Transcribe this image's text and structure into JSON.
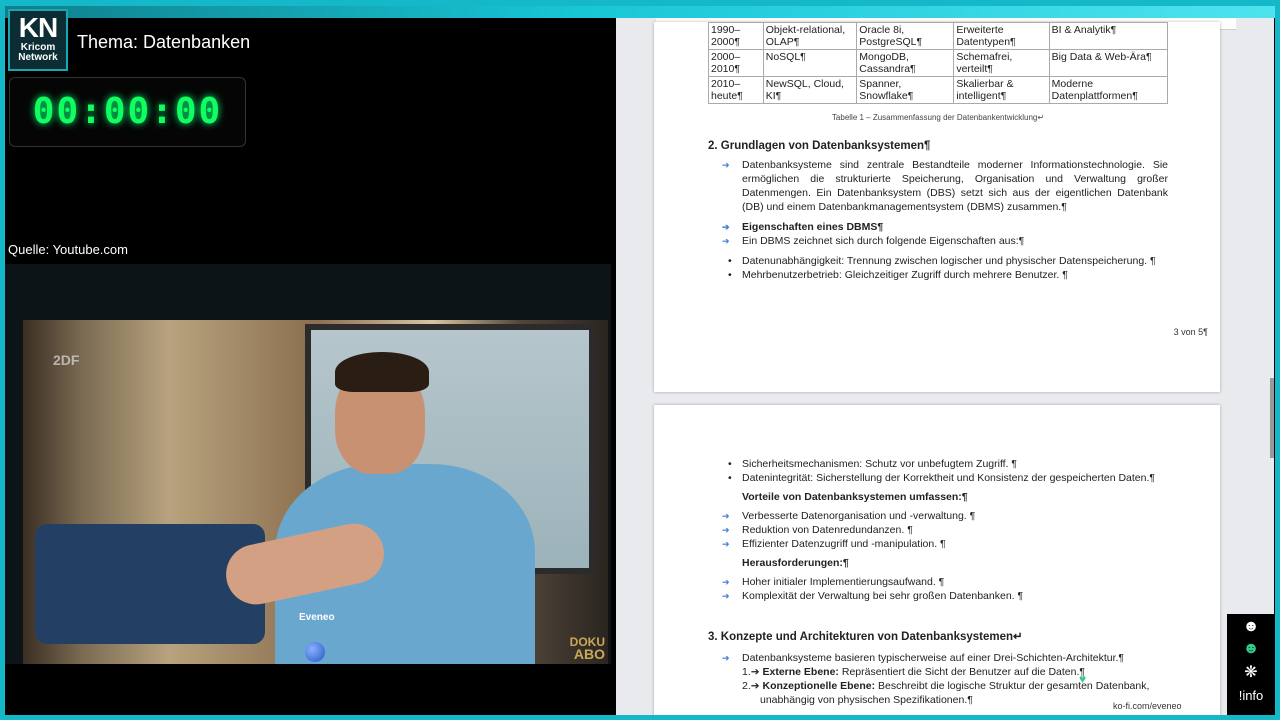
{
  "brand": {
    "logo_main": "KN",
    "logo_sub": "Kricom\nNetwork"
  },
  "header": {
    "topic": "Thema: Datenbanken"
  },
  "timer": {
    "value": "00:00:00"
  },
  "source": "Quelle: Youtube.com",
  "video": {
    "watermark": "2DF",
    "username": "Eveneo",
    "badge_top": "DOKU",
    "badge_bottom": "ABO"
  },
  "document": {
    "table_rows": [
      [
        "1990–2000¶",
        "Objekt-relational, OLAP¶",
        "Oracle 8i, PostgreSQL¶",
        "Erweiterte Datentypen¶",
        "BI & Analytik¶"
      ],
      [
        "2000–2010¶",
        "NoSQL¶",
        "MongoDB, Cassandra¶",
        "Schemafrei, verteilt¶",
        "Big Data & Web-Ära¶"
      ],
      [
        "2010–heute¶",
        "NewSQL, Cloud, KI¶",
        "Spanner, Snowflake¶",
        "Skalierbar & intelligent¶",
        "Moderne Datenplattformen¶"
      ]
    ],
    "caption": "Tabelle 1 – Zusammenfassung der Datenbankentwicklung↵",
    "section2_heading": "2. Grundlagen von Datenbanksystemen¶",
    "section2_para": "Datenbanksysteme sind zentrale Bestandteile moderner Informationstechnologie. Sie ermöglichen die strukturierte Speicherung, Organisation und Verwaltung großer Datenmengen. Ein Datenbanksystem (DBS) setzt sich aus der eigentlichen Datenbank (DB) und einem Datenbankmanagementsystem (DBMS) zusammen.¶",
    "dbms_heading": "Eigenschaften eines DBMS¶",
    "dbms_intro": "Ein DBMS zeichnet sich durch folgende Eigenschaften aus:¶",
    "dbms_props": [
      "Datenunabhängigkeit: Trennung zwischen logischer und physischer Datenspeicherung. ¶",
      "Mehrbenutzerbetrieb: Gleichzeitiger Zugriff durch mehrere Benutzer. ¶"
    ],
    "page_number": "3 von 5¶",
    "page2_bullets": [
      "Sicherheitsmechanismen: Schutz vor unbefugtem Zugriff. ¶",
      "Datenintegrität: Sicherstellung der Korrektheit und Konsistenz der gespeicherten Daten.¶"
    ],
    "advantages_heading": "Vorteile von Datenbanksystemen umfassen:¶",
    "advantages": [
      "Verbesserte Datenorganisation und -verwaltung. ¶",
      "Reduktion von Datenredundanzen. ¶",
      "Effizienter Datenzugriff und -manipulation. ¶"
    ],
    "challenges_heading": "Herausforderungen:¶",
    "challenges": [
      "Hoher initialer Implementierungsaufwand. ¶",
      "Komplexität der Verwaltung bei sehr großen Datenbanken. ¶"
    ],
    "section3_heading": "3. Konzepte und Architekturen von Datenbanksystemen↵",
    "section3_para": "Datenbanksysteme basieren typischerweise auf einer Drei-Schichten-Architektur.¶",
    "layers": [
      {
        "num": "1.➔",
        "name": "Externe Ebene:",
        "text": " Repräsentiert die Sicht der Benutzer auf die Daten.¶"
      },
      {
        "num": "2.➔",
        "name": "Konzeptionelle Ebene:",
        "text": " Beschreibt die logische Struktur der gesamten Datenbank,"
      }
    ],
    "layer_cont": "unabhängig von physischen Spezifikationen.¶"
  },
  "overlay": {
    "link": "ko-fi.com/eveneo"
  },
  "sidebar": {
    "info_label": "!info"
  }
}
